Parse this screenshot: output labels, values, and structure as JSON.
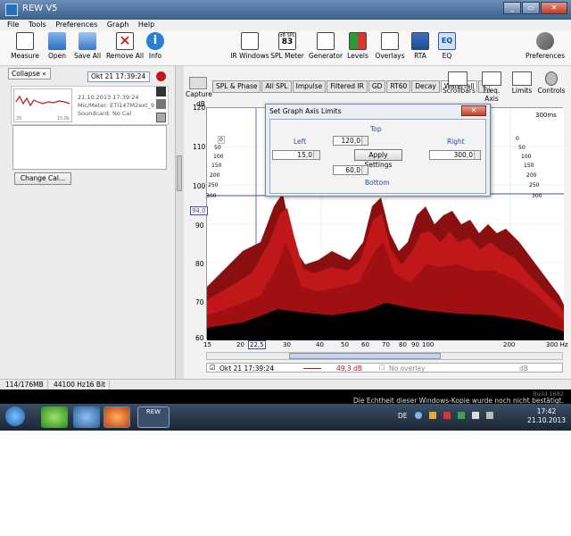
{
  "window": {
    "title": "REW V5"
  },
  "menu": [
    "File",
    "Tools",
    "Preferences",
    "Graph",
    "Help"
  ],
  "toolbar": {
    "left": [
      "Measure",
      "Open",
      "Save All",
      "Remove All",
      "Info"
    ],
    "center": [
      "IR Windows",
      "SPL Meter",
      "Generator",
      "Levels",
      "Overlays",
      "RTA",
      "EQ"
    ],
    "spl_icon_text": "dB SPL",
    "spl_icon_value": "83",
    "right": "Preferences"
  },
  "left_panel": {
    "collapse": "Collapse",
    "measurement_name": "Okt 21 17:39:24",
    "thumb_left": "20",
    "thumb_right": "15,0k",
    "info_date": "21.10.2013 17:39:24",
    "info_mic": "Mic/Meter: ETI147M2ext_9",
    "info_soundcard": "Soundcard: No Cal",
    "change_cal": "Change Cal..."
  },
  "graph_tabs": [
    "SPL & Phase",
    "All SPL",
    "Impulse",
    "Filtered IR",
    "GD",
    "RT60",
    "Decay",
    "Waterfall",
    "»"
  ],
  "capture": "Capture",
  "graph_tools": [
    "Scrollbars",
    "Freq. Axis",
    "Limits",
    "Controls"
  ],
  "graph": {
    "y_unit": "dB",
    "time_label": "300ms",
    "y_ticks": [
      "120",
      "110",
      "100",
      "90",
      "80",
      "70",
      "60"
    ],
    "x_ticks": [
      "15",
      "20",
      "22,5",
      "30",
      "40",
      "50",
      "60",
      "70",
      "80",
      "90",
      "100",
      "200",
      "300 Hz"
    ],
    "marker_label": "94,0",
    "left_time_ticks": [
      "0",
      "50",
      "100",
      "150",
      "200",
      "250",
      "300"
    ],
    "right_time_ticks": [
      "0",
      "50",
      "100",
      "150",
      "200",
      "250",
      "300"
    ]
  },
  "dialog": {
    "title": "Set Graph Axis Limits",
    "close": "✕",
    "top_label": "Top",
    "left_label": "Left",
    "right_label": "Right",
    "bottom_label": "Bottom",
    "top_value": "120,0",
    "left_value": "15,0",
    "right_value": "300,0",
    "bottom_value": "60,0",
    "apply": "Apply Settings"
  },
  "overlay_bar": {
    "name": "Okt 21 17:39:24",
    "level": "49,3 dB",
    "no_overlay": "No overlay",
    "unit": "dB"
  },
  "status": {
    "memory": "114/176MB",
    "rate": "44100 Hz",
    "bits": "16 Bit"
  },
  "desktop": {
    "build": "Build 1682",
    "activation": "Die Echtheit dieser Windows-Kopie wurde noch nicht bestätigt.",
    "lang": "DE",
    "time": "17:42",
    "date": "21.10.2013",
    "rew_label": "REW"
  },
  "colors": {
    "accent": "#c0181a",
    "graph_line": "#3a4fb0"
  }
}
